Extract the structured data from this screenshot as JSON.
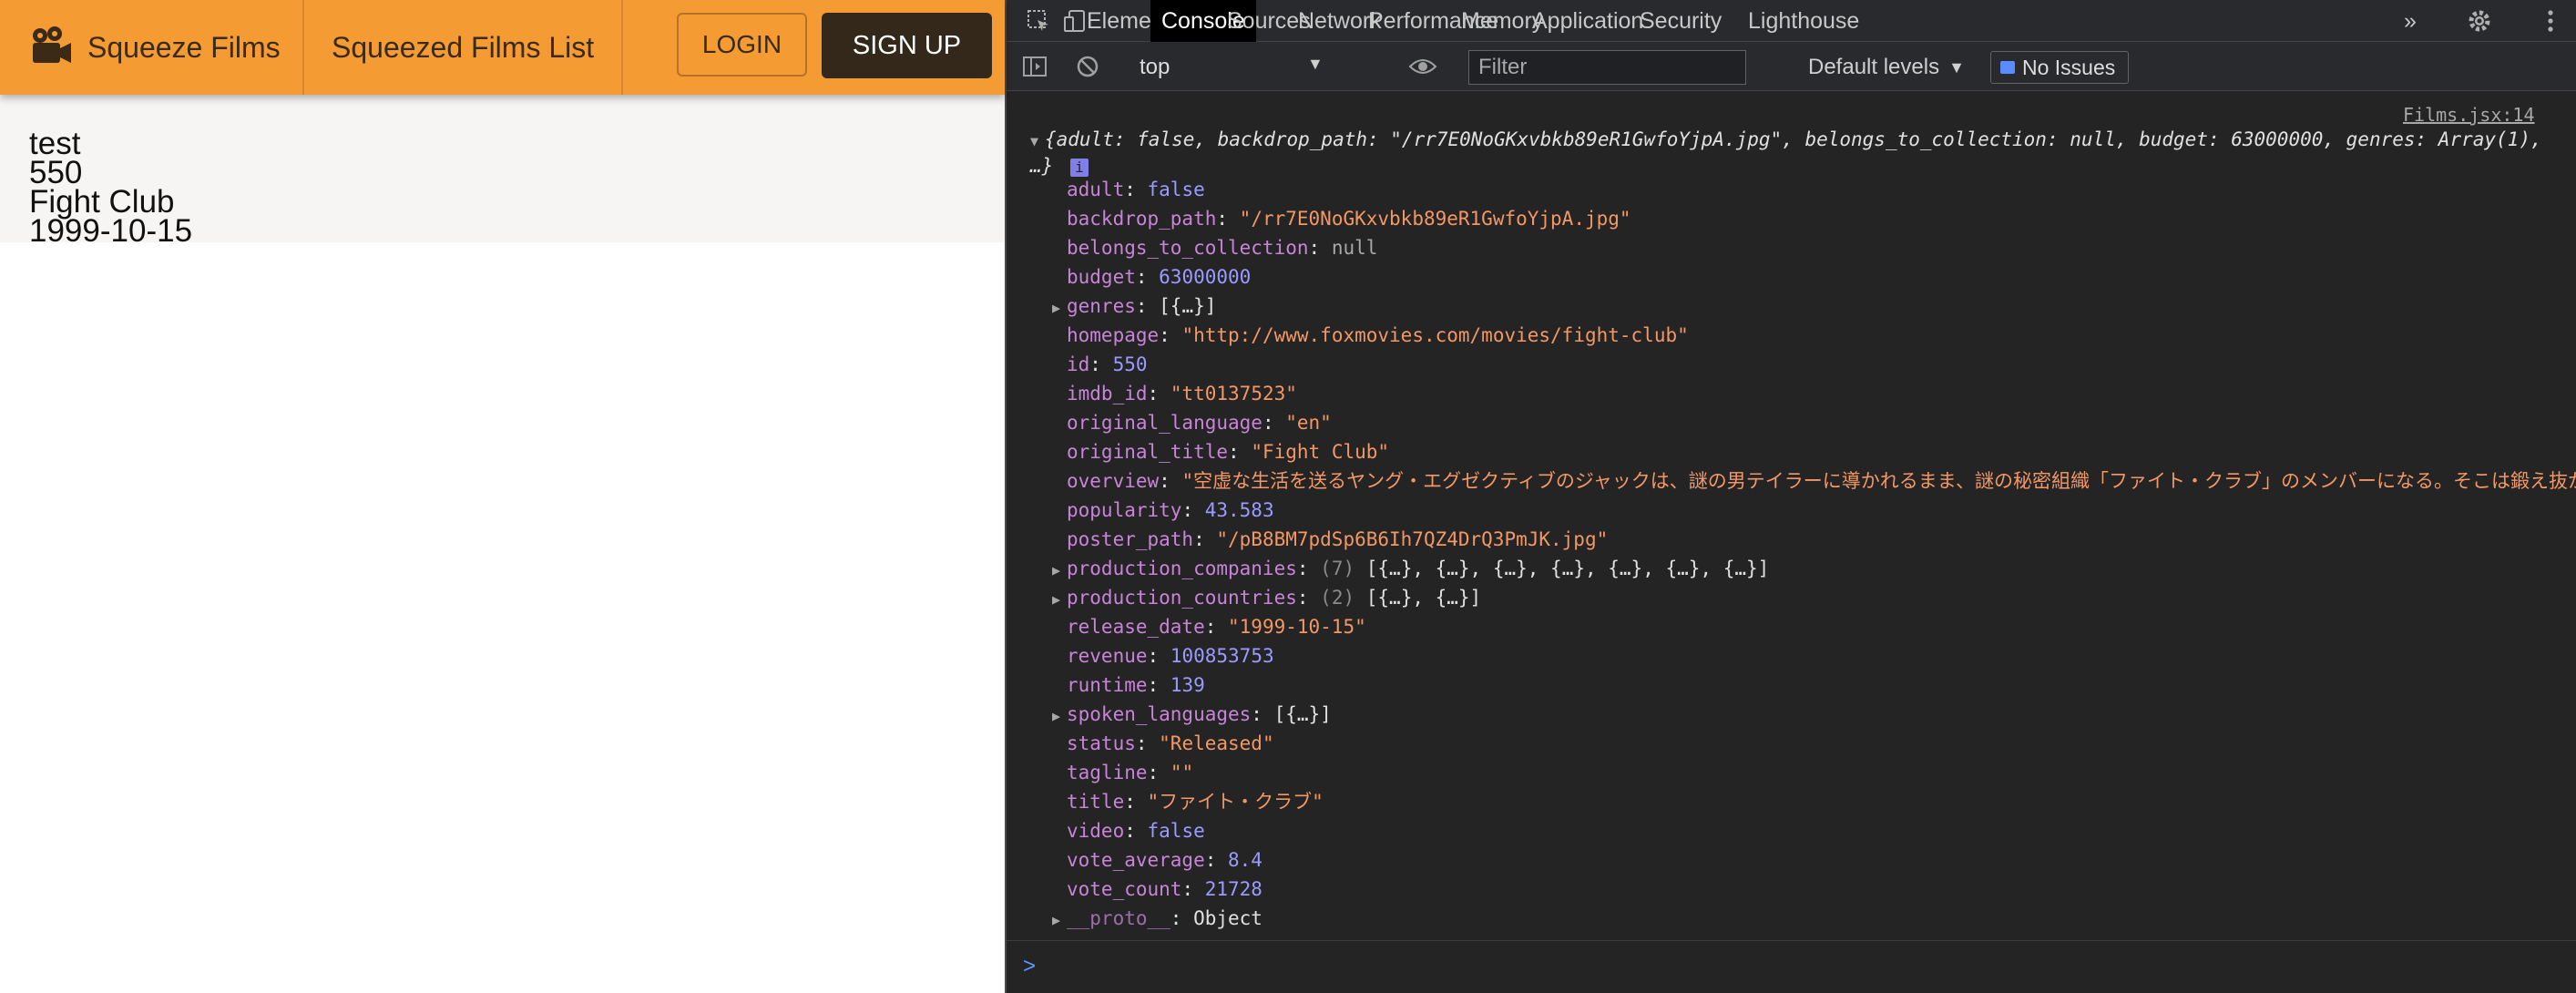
{
  "app": {
    "brand_name": "Squeeze Films",
    "nav_link": "Squeezed Films List",
    "login_label": "LOGIN",
    "signup_label": "SIGN UP",
    "film": {
      "line1": "test",
      "line2": "550",
      "line3": "Fight Club",
      "line4": "1999-10-15"
    }
  },
  "devtools": {
    "tabs": [
      "Elements",
      "Console",
      "Sources",
      "Network",
      "Performance",
      "Memory",
      "Application",
      "Security",
      "Lighthouse"
    ],
    "active_tab": "Console",
    "more_tabs_icon": "»",
    "context": "top",
    "filter_placeholder": "Filter",
    "levels": "Default levels",
    "issues": "No Issues",
    "source_link": "Films.jsx:14",
    "summary": "{adult: false, backdrop_path: \"/rr7E0NoGKxvbkb89eR1GwfoYjpA.jpg\", belongs_to_collection: null, budget: 63000000, genres: Array(1), …}",
    "summary_info_icon": "i",
    "properties": [
      {
        "key": "adult",
        "value": "false",
        "type": "bool",
        "expandable": false
      },
      {
        "key": "backdrop_path",
        "value": "\"/rr7E0NoGKxvbkb89eR1GwfoYjpA.jpg\"",
        "type": "str",
        "expandable": false
      },
      {
        "key": "belongs_to_collection",
        "value": "null",
        "type": "nul",
        "expandable": false
      },
      {
        "key": "budget",
        "value": "63000000",
        "type": "num",
        "expandable": false
      },
      {
        "key": "genres",
        "value": "[{…}]",
        "type": "obj",
        "expandable": true
      },
      {
        "key": "homepage",
        "value": "\"http://www.foxmovies.com/movies/fight-club\"",
        "type": "str",
        "expandable": false
      },
      {
        "key": "id",
        "value": "550",
        "type": "num",
        "expandable": false
      },
      {
        "key": "imdb_id",
        "value": "\"tt0137523\"",
        "type": "str",
        "expandable": false
      },
      {
        "key": "original_language",
        "value": "\"en\"",
        "type": "str",
        "expandable": false
      },
      {
        "key": "original_title",
        "value": "\"Fight Club\"",
        "type": "str",
        "expandable": false
      },
      {
        "key": "overview",
        "value": "\"空虚な生活を送るヤング・エグゼクティブのジャックは、謎の男テイラーに導かれるまま、謎の秘密組織「ファイト・クラブ」のメンバーになる。そこは鍛え抜かれ…",
        "type": "str",
        "expandable": false
      },
      {
        "key": "popularity",
        "value": "43.583",
        "type": "num",
        "expandable": false
      },
      {
        "key": "poster_path",
        "value": "\"/pB8BM7pdSp6B6Ih7QZ4DrQ3PmJK.jpg\"",
        "type": "str",
        "expandable": false
      },
      {
        "key": "production_companies",
        "count": "(7)",
        "value": "[{…}, {…}, {…}, {…}, {…}, {…}, {…}]",
        "type": "obj",
        "expandable": true
      },
      {
        "key": "production_countries",
        "count": "(2)",
        "value": "[{…}, {…}]",
        "type": "obj",
        "expandable": true
      },
      {
        "key": "release_date",
        "value": "\"1999-10-15\"",
        "type": "str",
        "expandable": false
      },
      {
        "key": "revenue",
        "value": "100853753",
        "type": "num",
        "expandable": false
      },
      {
        "key": "runtime",
        "value": "139",
        "type": "num",
        "expandable": false
      },
      {
        "key": "spoken_languages",
        "value": "[{…}]",
        "type": "obj",
        "expandable": true
      },
      {
        "key": "status",
        "value": "\"Released\"",
        "type": "str",
        "expandable": false
      },
      {
        "key": "tagline",
        "value": "\"\"",
        "type": "str",
        "expandable": false
      },
      {
        "key": "title",
        "value": "\"ファイト・クラブ\"",
        "type": "str",
        "expandable": false
      },
      {
        "key": "video",
        "value": "false",
        "type": "bool",
        "expandable": false
      },
      {
        "key": "vote_average",
        "value": "8.4",
        "type": "num",
        "expandable": false
      },
      {
        "key": "vote_count",
        "value": "21728",
        "type": "num",
        "expandable": false
      },
      {
        "key": "__proto__",
        "value": "Object",
        "type": "obj",
        "expandable": true
      }
    ],
    "prompt_caret": ">"
  },
  "colors": {
    "navbar": "#f49b34",
    "signup": "#33281a",
    "devtools_bg": "#242424",
    "key": "#c884d8",
    "string": "#f29766",
    "number": "#9b9bff"
  }
}
